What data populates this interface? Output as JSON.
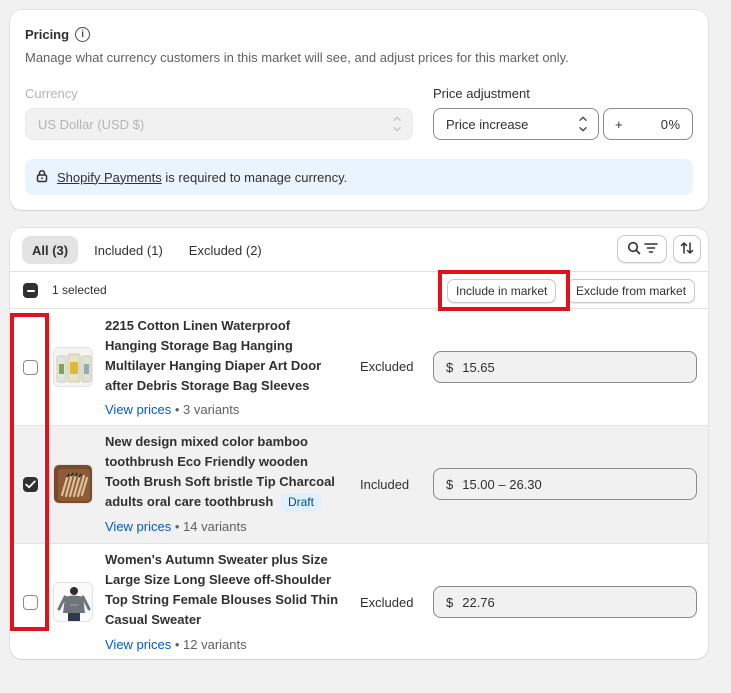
{
  "pricing": {
    "title": "Pricing",
    "description": "Manage what currency customers in this market will see, and adjust prices for this market only.",
    "currency_label": "Currency",
    "currency_value": "US Dollar (USD $)",
    "adjustment_label": "Price adjustment",
    "adjustment_value": "Price increase",
    "percent_prefix": "+",
    "percent_value": "0",
    "percent_suffix": "%",
    "banner_link": "Shopify Payments",
    "banner_text": "is required to manage currency."
  },
  "tabs": [
    {
      "label": "All (3)",
      "active": true
    },
    {
      "label": "Included (1)",
      "active": false
    },
    {
      "label": "Excluded (2)",
      "active": false
    }
  ],
  "bulk": {
    "selected_text": "1 selected",
    "include_label": "Include in market",
    "exclude_label": "Exclude from market"
  },
  "products": [
    {
      "name": "2215 Cotton Linen Waterproof Hanging Storage Bag Hanging Multilayer Hanging Diaper Art Door after Debris Storage Bag Sleeves",
      "badge": "",
      "view_prices": "View prices",
      "variants": "3 variants",
      "status": "Excluded",
      "currency_symbol": "$",
      "price": "15.65",
      "checked": false
    },
    {
      "name": "New design mixed color bamboo toothbrush Eco Friendly wooden Tooth Brush Soft bristle Tip Charcoal adults oral care toothbrush",
      "badge": "Draft",
      "view_prices": "View prices",
      "variants": "14 variants",
      "status": "Included",
      "currency_symbol": "$",
      "price": "15.00 – 26.30",
      "checked": true
    },
    {
      "name": "Women's Autumn Sweater plus Size Large Size Long Sleeve off-Shoulder Top String Female Blouses Solid Thin Casual Sweater",
      "badge": "",
      "view_prices": "View prices",
      "variants": "12 variants",
      "status": "Excluded",
      "currency_symbol": "$",
      "price": "22.76",
      "checked": false
    }
  ],
  "icons": {
    "info": "info-icon",
    "lock": "lock-icon",
    "search_filter": "search-filter-icon",
    "sort": "sort-icon",
    "select_arrows": "chevron-up-down-icon"
  },
  "colors": {
    "link": "#005bd3",
    "annotation": "#e0121b",
    "banner_bg": "#eaf4ff",
    "draft_badge_bg": "#e0f0ff"
  }
}
